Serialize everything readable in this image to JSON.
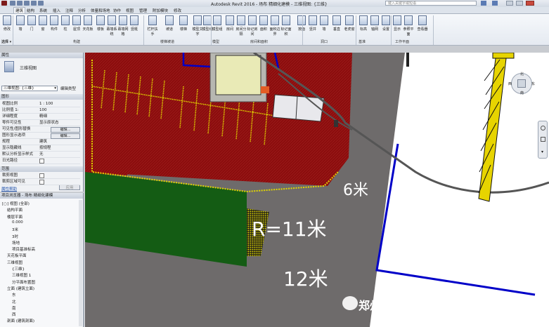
{
  "app": {
    "title": "Autodesk Revit 2016 -  场布 精细化建模 - 三维视图: {三维}",
    "search_placeholder": "键入关键字或短语"
  },
  "ribbon": {
    "tabs": [
      "建筑",
      "结构",
      "系统",
      "插入",
      "注释",
      "分析",
      "体量和场地",
      "协作",
      "视图",
      "管理",
      "附加模块",
      "修改"
    ],
    "active_tab": "建筑",
    "buttons": [
      "修改",
      "墙",
      "门",
      "窗",
      "构件",
      "柱",
      "屋顶",
      "天花板",
      "楼板",
      "幕墙系统",
      "幕墙网格",
      "竖梃",
      "栏杆扶手",
      "坡道",
      "楼梯",
      "模型文字",
      "模型线",
      "模型组",
      "房间",
      "房间分隔",
      "标记房间",
      "面积",
      "面积边界",
      "标记面积",
      "按面",
      "竖井",
      "墙",
      "垂直",
      "老虎窗",
      "标高",
      "轴网",
      "设置",
      "显示",
      "参照平面",
      "查看器"
    ],
    "groups": [
      "选择",
      "构建",
      "楼梯坡道",
      "模型",
      "房间和面积",
      "洞口",
      "基准",
      "工作平面"
    ]
  },
  "properties": {
    "header": "属性",
    "type_name": "三维视图",
    "view_selector": "三维视图: {三维}",
    "edit_type": "编辑类型",
    "section_graphics": "图形",
    "rows": [
      {
        "k": "视图比例",
        "v": "1 : 100"
      },
      {
        "k": "比例值 1:",
        "v": "100"
      },
      {
        "k": "详细程度",
        "v": "精细"
      },
      {
        "k": "零件可见性",
        "v": "显示原状态"
      },
      {
        "k": "可见性/图形替换",
        "v": "编辑..."
      },
      {
        "k": "图形显示选项",
        "v": "编辑..."
      },
      {
        "k": "规程",
        "v": "建筑"
      },
      {
        "k": "显示隐藏线",
        "v": "按规程"
      },
      {
        "k": "默认分析显示样式",
        "v": "无"
      },
      {
        "k": "日光路径",
        "v": ""
      }
    ],
    "section_range": "范围",
    "rows2": [
      {
        "k": "裁剪视图",
        "v": ""
      },
      {
        "k": "裁剪区域可见",
        "v": ""
      }
    ],
    "help_link": "属性帮助",
    "apply": "应用"
  },
  "browser": {
    "header": "项目浏览器 - 场布 精细化建模",
    "nodes": [
      {
        "t": "[○] 视图 (全部)",
        "l": 0
      },
      {
        "t": "结构平面",
        "l": 1
      },
      {
        "t": "楼层平面",
        "l": 1
      },
      {
        "t": "0.000",
        "l": 2
      },
      {
        "t": "3米",
        "l": 2
      },
      {
        "t": "3时",
        "l": 2
      },
      {
        "t": "场地",
        "l": 2
      },
      {
        "t": "项目基准标高",
        "l": 2
      },
      {
        "t": "天花板平面",
        "l": 1
      },
      {
        "t": "三维视图",
        "l": 1
      },
      {
        "t": "{三维}",
        "l": 2
      },
      {
        "t": "三维视图 1",
        "l": 2
      },
      {
        "t": "分平面布置图",
        "l": 2
      },
      {
        "t": "立面 (建筑立面)",
        "l": 1
      },
      {
        "t": "东",
        "l": 2
      },
      {
        "t": "北",
        "l": 2
      },
      {
        "t": "南",
        "l": 2
      },
      {
        "t": "西",
        "l": 2
      },
      {
        "t": "剖面 (建筑剖面)",
        "l": 1
      }
    ]
  },
  "viewport": {
    "dim_6": "6米",
    "dim_r11": "R=11米",
    "dim_12": "12米",
    "watermark": "郑州一建集团BIM技术中心",
    "nav_labels": {
      "top": "北",
      "bottom": "南",
      "left": "西",
      "right": "东"
    }
  },
  "colors": {
    "red_zone": "#8b0d0d",
    "green_zone": "#145c14",
    "road": "#6e6b6b",
    "yellow": "#e2d600",
    "blue_boundary": "#0000c8"
  }
}
